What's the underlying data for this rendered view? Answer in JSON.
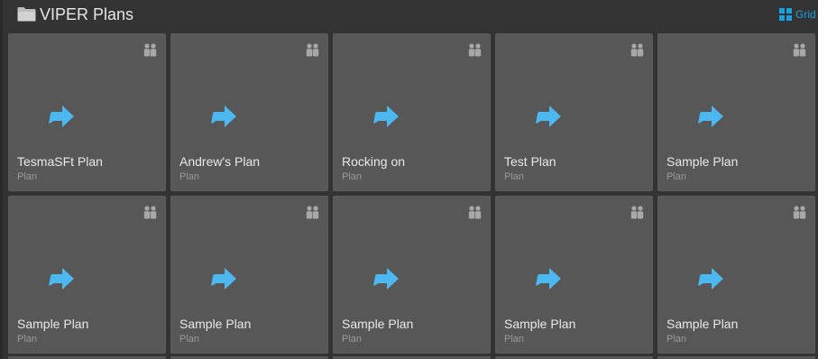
{
  "header": {
    "title": "VIPER Plans",
    "folder_icon": "folder-icon",
    "view_toggle_label": "Grid",
    "view_toggle_icon": "grid-icon"
  },
  "colors": {
    "background": "#333333",
    "tile": "#575757",
    "accent": "#1a9fe0",
    "arrow": "#4db8f0"
  },
  "tiles": [
    {
      "name": "TesmaSFt Plan",
      "type": "Plan",
      "icon": "arrow-icon",
      "badge": "shared-users-icon"
    },
    {
      "name": "Andrew's Plan",
      "type": "Plan",
      "icon": "arrow-icon",
      "badge": "shared-users-icon"
    },
    {
      "name": "Rocking on",
      "type": "Plan",
      "icon": "arrow-icon",
      "badge": "shared-users-icon"
    },
    {
      "name": "Test Plan",
      "type": "Plan",
      "icon": "arrow-icon",
      "badge": "shared-users-icon"
    },
    {
      "name": "Sample Plan",
      "type": "Plan",
      "icon": "arrow-icon",
      "badge": "shared-users-icon"
    },
    {
      "name": "Sample Plan",
      "type": "Plan",
      "icon": "arrow-icon",
      "badge": "shared-users-icon"
    },
    {
      "name": "Sample Plan",
      "type": "Plan",
      "icon": "arrow-icon",
      "badge": "shared-users-icon"
    },
    {
      "name": "Sample Plan",
      "type": "Plan",
      "icon": "arrow-icon",
      "badge": "shared-users-icon"
    },
    {
      "name": "Sample Plan",
      "type": "Plan",
      "icon": "arrow-icon",
      "badge": "shared-users-icon"
    },
    {
      "name": "Sample Plan",
      "type": "Plan",
      "icon": "arrow-icon",
      "badge": "shared-users-icon"
    }
  ]
}
